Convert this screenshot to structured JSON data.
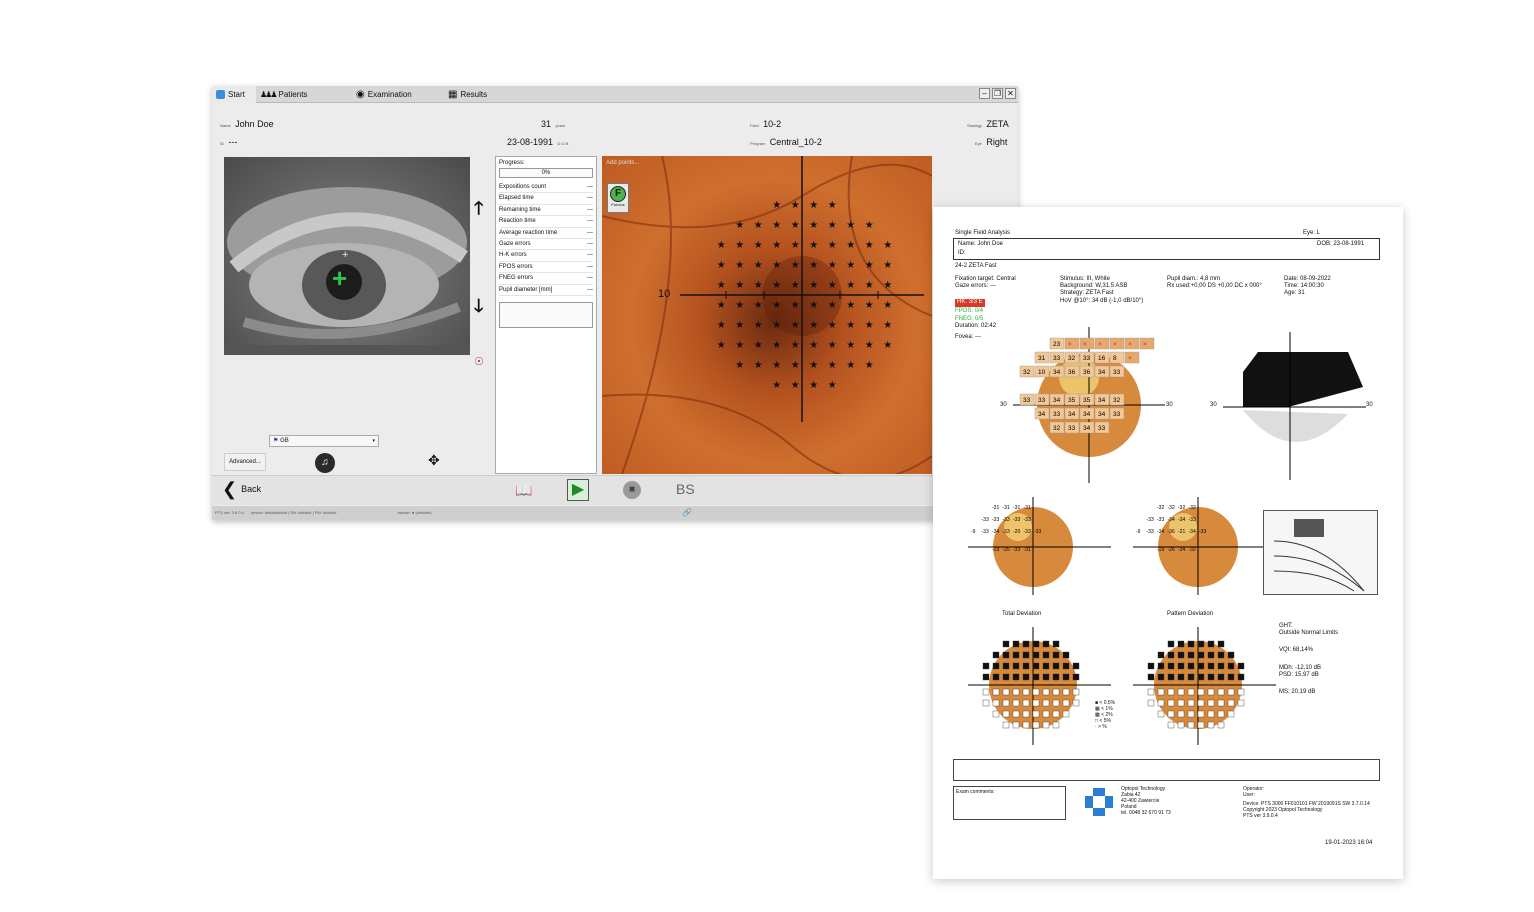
{
  "app": {
    "tabs": [
      {
        "label": "Start",
        "icon": "start-icon"
      },
      {
        "label": "Patients",
        "icon": "patients-icon"
      },
      {
        "label": "Examination",
        "icon": "examination-icon"
      },
      {
        "label": "Results",
        "icon": "results-icon"
      }
    ],
    "header": {
      "name_label": "Name",
      "name": "John Doe",
      "id_label": "ID",
      "id": "---",
      "age": "31",
      "age_unit": "years",
      "dob": "23-08-1991",
      "dob_label": "D.O.B",
      "field_label": "Field",
      "field": "10-2",
      "program_label": "Program",
      "program": "Central_10-2",
      "strategy_label": "Strategy",
      "strategy": "ZETA",
      "eye_label": "Eye",
      "eye": "Right"
    },
    "progress": {
      "title": "Progress:",
      "percent_text": "0%",
      "value": 0,
      "rows": [
        {
          "label": "Expositions count",
          "value": "---"
        },
        {
          "label": "Elapsed time",
          "value": "---"
        },
        {
          "label": "Remaining time",
          "value": "---"
        },
        {
          "label": "Reaction time",
          "value": "---"
        },
        {
          "label": "Average reaction time",
          "value": "---"
        },
        {
          "label": "Gaze errors",
          "value": "---"
        },
        {
          "label": "H-K errors",
          "value": "---"
        },
        {
          "label": "FPOS errors",
          "value": "---"
        },
        {
          "label": "FNEG errors",
          "value": "---"
        },
        {
          "label": "Pupil diameter [mm]",
          "value": "---"
        }
      ]
    },
    "fundus": {
      "placeholder": "Add points...",
      "fundus_badge": "F",
      "fundus_label": "Fundus",
      "axis_label": "10"
    },
    "language": "GB",
    "advanced_label": "Advanced...",
    "back_label": "Back",
    "bs_label": "BS",
    "status": {
      "left": "PTS ver: 3.9.0.4",
      "mid1": "device: ##########  |  SN: ######  |  FW: ######",
      "mid2": "tracker: ● (######)"
    },
    "colors": {
      "accent_green": "#2fae3f",
      "fundus_orange": "#c8622a",
      "hk_red": "#d83a2a"
    }
  },
  "report": {
    "title": "Single Field Analysis",
    "eye": "Eye: L",
    "name": "Name: John Doe",
    "id": "ID:",
    "dob": "DOB: 23-08-1991",
    "test": "24-2 ZETA Fast",
    "fixation": "Fixation target: Central",
    "gaze": "Gaze errors: ---",
    "hk": "HK: 3/3 E",
    "fpos": "FPOS: 0/4",
    "fneg": "FNEG: 0/5",
    "duration": "Duration: 02:42",
    "fovea": "Fovea: ---",
    "stimulus": "Stimulus: III, White",
    "background": "Background: W,31.5 ASB",
    "strategy": "Strategy: ZETA Fast",
    "hov": "HoV @10°: 34 dB (-1,0 dB/10°)",
    "pupil": "Pupil diam.: 4,8 mm",
    "rx": "Rx used:+0,00 DS +0,00 DC x 000°",
    "date": "Date: 08-09-2022",
    "time": "Time: 14:00:30",
    "age": "Age: 31",
    "axis30": "30",
    "sens_rows": [
      [
        "23",
        "×",
        "×",
        "×",
        "×",
        "×",
        "×"
      ],
      [
        "31",
        "33",
        "32",
        "33",
        "16",
        "8",
        "×"
      ],
      [
        "32",
        "10",
        "34",
        "36",
        "36",
        "34",
        "33"
      ],
      [
        "33",
        "33",
        "34",
        "35",
        "35",
        "34",
        "32"
      ],
      [
        "34",
        "33",
        "34",
        "34",
        "34",
        "33"
      ],
      [
        "32",
        "33",
        "34",
        "33"
      ]
    ],
    "td_label": "Total Deviation",
    "pd_label": "Pattern Deviation",
    "td_rows": [
      [
        "-31",
        "-31",
        "-31",
        "-31"
      ],
      [
        "-33",
        "-33",
        "-33",
        "-33",
        "-33"
      ],
      [
        "-9",
        "-33",
        "-34",
        "-33",
        "-20",
        "-33",
        "-33"
      ],
      [
        "-19",
        "-25",
        "-33",
        "-31"
      ]
    ],
    "pd_rows": [
      [
        "-32",
        "-32",
        "-32",
        "-32"
      ],
      [
        "-33",
        "-33",
        "-34",
        "-34",
        "-33"
      ],
      [
        "-9",
        "-33",
        "-34",
        "-36",
        "-21",
        "-34",
        "-33"
      ],
      [
        "-19",
        "-26",
        "-34",
        "-32"
      ]
    ],
    "ght_title": "GHT:",
    "ght_value": "Outside Normal Limits",
    "vqi": "VQI: 68,14%",
    "mdh": "MDh: -12,10 dB",
    "psd": "PSD: 15,97 dB",
    "ms": "MS: 20,19 dB",
    "legend": [
      "< 0.5%",
      "< 1%",
      "< 2%",
      "< 5%",
      "> %"
    ],
    "exam_comments": "Exam comments:",
    "company": [
      "Optopol Technology",
      "Zabia 42",
      "42-400 Zawiercie",
      "Poland",
      "tel. 0048 32 670 91 73"
    ],
    "operator": [
      "Operator:",
      "User:"
    ],
    "device": [
      "Device: PTS 3000 FF010101 FW 2019091S SW 3.7.0.14",
      "Copyright 2023 Optopol Technology",
      "PTS ver 3.9.0.4"
    ],
    "printed": "19-01-2023 16:04"
  }
}
